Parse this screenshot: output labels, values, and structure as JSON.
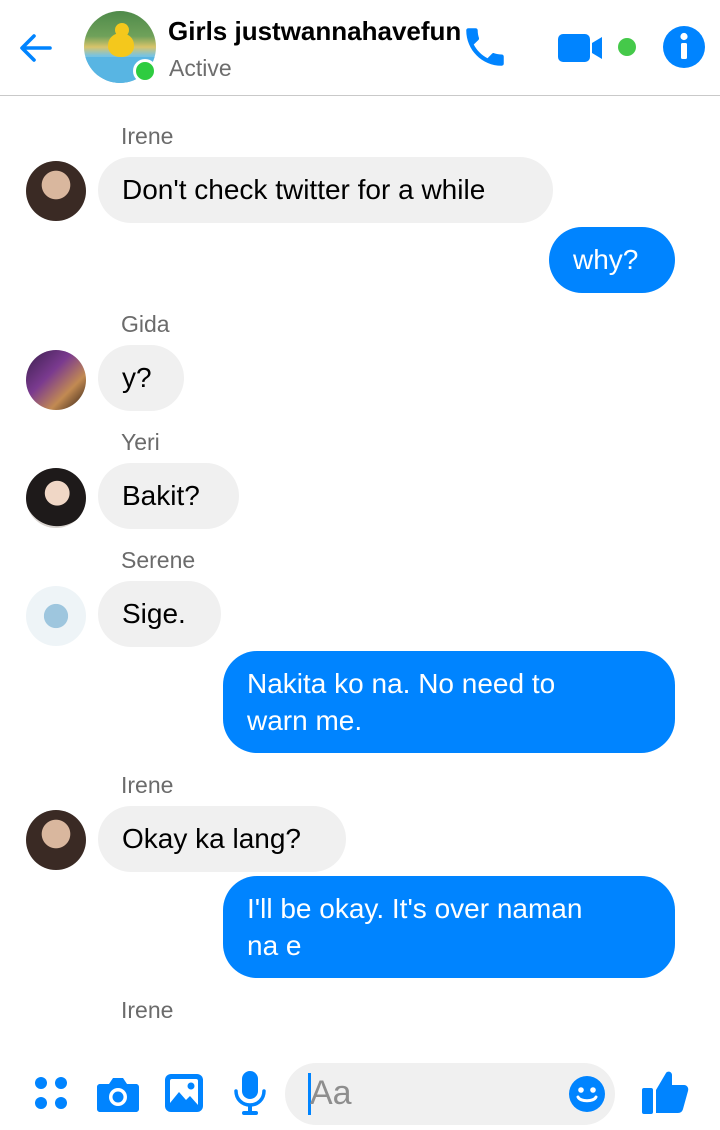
{
  "header": {
    "title": "Girls justwannahavefun",
    "status": "Active"
  },
  "messages": [
    {
      "type": "in",
      "sender": "Irene",
      "text": "Don't check twitter for a while"
    },
    {
      "type": "out",
      "text": "why?"
    },
    {
      "type": "in",
      "sender": "Gida",
      "text": "y?"
    },
    {
      "type": "in",
      "sender": "Yeri",
      "text": "Bakit?"
    },
    {
      "type": "in",
      "sender": "Serene",
      "text": "Sige."
    },
    {
      "type": "out",
      "lines": [
        "Nakita ko na. No need to",
        "warn me."
      ]
    },
    {
      "type": "in",
      "sender": "Irene",
      "text": "Okay ka lang?"
    },
    {
      "type": "out",
      "lines": [
        "I'll be okay. It's over naman",
        "na e"
      ]
    },
    {
      "type": "typing",
      "sender": "Irene"
    }
  ],
  "composer": {
    "placeholder": "Aa"
  },
  "colors": {
    "accent": "#0084ff",
    "incoming_bubble": "#f0f0f0",
    "active_green": "#2ecc40"
  },
  "icons": [
    "back-arrow-icon",
    "phone-icon",
    "video-camera-icon",
    "info-icon",
    "apps-grid-icon",
    "camera-icon",
    "gallery-icon",
    "microphone-icon",
    "emoji-icon",
    "thumbs-up-icon"
  ]
}
